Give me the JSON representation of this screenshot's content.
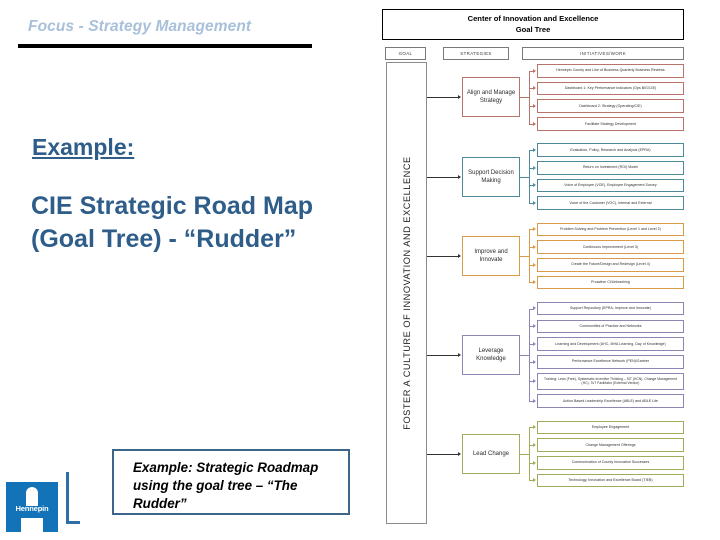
{
  "slide": {
    "title": "Focus - Strategy Management",
    "example_label": "Example:",
    "example_body": "CIE Strategic Road Map (Goal Tree)  -  “Rudder”",
    "caption": "Example: Strategic Roadmap using the goal tree – “The Rudder”",
    "logo_word": "Hennepin",
    "colors": {
      "title": "#a8c0da",
      "body_text": "#2e5d8a",
      "caption_border": "#3c6589",
      "logo": "#1273b8"
    }
  },
  "goal_tree": {
    "header_line1": "Center of Innovation and Excellence",
    "header_line2": "Goal Tree",
    "column_headers": {
      "goal": "GOAL",
      "strategies": "STRATEGIES",
      "initiatives": "INITIATIVES/WORK"
    },
    "goal": "FOSTER A CULTURE OF INNOVATION AND EXCELLENCE",
    "groups": [
      {
        "strategy": "Align and Manage Strategy",
        "color": "#b8736b",
        "initiatives": [
          "Hennepin County and Line of Business Quarterly Business Reviews",
          "Dashboard 1: Key Performance Indicators (Ops BIG/CIE)",
          "Dashboard 2: Strategy (Operating/CIE)",
          "Facilitate Strategy Development"
        ]
      },
      {
        "strategy": "Support Decision Making",
        "color": "#4f8a9b",
        "initiatives": [
          "Evaluation, Policy, Research and Analysis (EPRA)",
          "Return on Investment (ROI) Model",
          "Voice of Employee (VOE), Employee Engagement Survey",
          "Voice of the Customer (VOC), Internal and External"
        ]
      },
      {
        "strategy": "Improve and Innovate",
        "color": "#d99b4a",
        "initiatives": [
          "Problem Solving and Problem Prevention (Level 1 and Level 2)",
          "Continuous Improvement (Level 3)",
          "Create the Future/Design and Redesign (Level 4)",
          "Proactive CI/Unleashing"
        ]
      },
      {
        "strategy": "Leverage Knowledge",
        "color": "#8f85b5",
        "initiatives": [
          "Support Repository (EPRA, Improve and Innovate)",
          "Communities of Practice and Networks",
          "Learning and Development (UHC, MHA Learning, Day of Knowledge)",
          "Performance Excellence Network (PEN)/Gartner",
          "Training: Lean (Free), Systematic Inventive Thinking – SIT (HCN), Change Management (HC), ToT Facilitator (External Vendor)",
          "Action Based Leadership Excellence (ABLE) and ABLE Lite"
        ]
      },
      {
        "strategy": "Lead Change",
        "color": "#a2ac5a",
        "initiatives": [
          "Employee Engagement",
          "Change Management Offerings",
          "Communication of County Innovation Successes",
          "Technology, Innovation and Excellence Board (TIEB)"
        ]
      }
    ]
  }
}
